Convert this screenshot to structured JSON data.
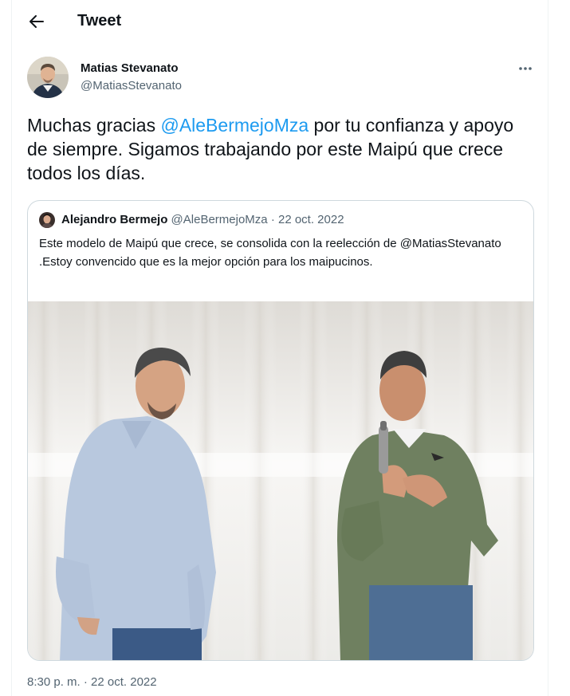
{
  "header": {
    "title": "Tweet",
    "back_icon": "arrow-left-icon"
  },
  "tweet": {
    "author": {
      "name": "Matias Stevanato",
      "handle": "@MatiasStevanato"
    },
    "text": {
      "part1": "Muchas gracias ",
      "mention": "@AleBermejoMza",
      "part2": " por tu confianza y apoyo de siempre. Sigamos trabajando por este Maipú que crece todos los días."
    },
    "timestamp": "8:30 p. m. · 22 oct. 2022"
  },
  "quoted_tweet": {
    "author_name": "Alejandro Bermejo",
    "meta": "@AleBermejoMza · 22 oct. 2022",
    "text": "Este modelo de Maipú que crece, se consolida con la reelección de @MatiasStevanato .Estoy convencido que es la mejor opción para los maipucinos."
  },
  "colors": {
    "accent": "#1d9bf0",
    "text": "#0f1419",
    "secondary_text": "#536471",
    "border": "#cfd9de"
  }
}
